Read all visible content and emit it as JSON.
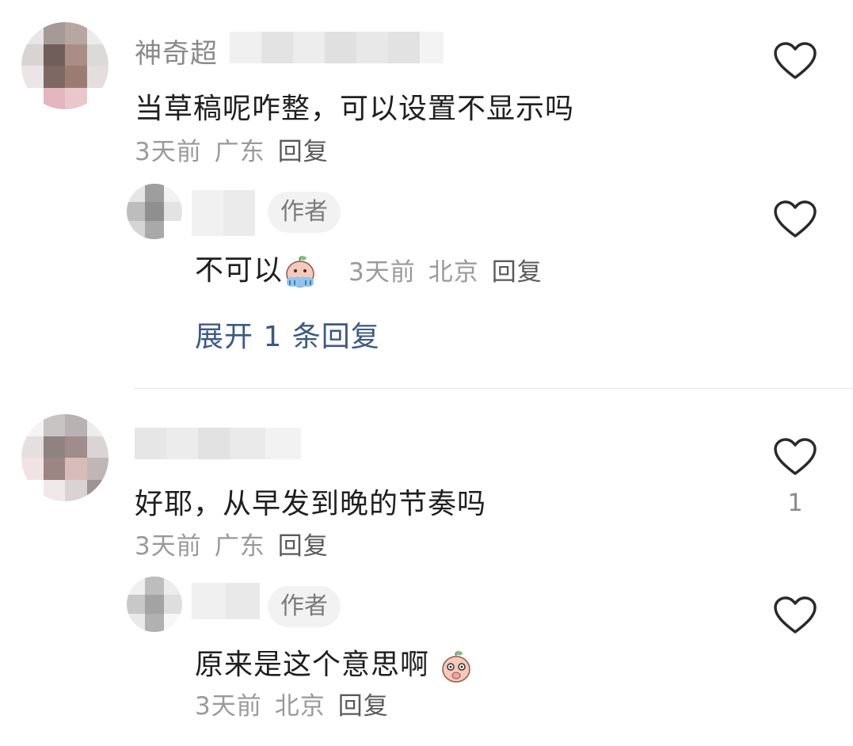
{
  "comments": [
    {
      "username_visible": "神奇超",
      "text": "当草稿呢咋整，可以设置不显示吗",
      "time": "3天前",
      "location": "广东",
      "reply_label": "回复",
      "likes": "",
      "replies": [
        {
          "author_tag": "作者",
          "text": "不可以",
          "emoji": "crying-emoji",
          "time": "3天前",
          "location": "北京",
          "reply_label": "回复"
        }
      ],
      "expand_label": "展开 1 条回复"
    },
    {
      "username_visible": "",
      "text": "好耶，从早发到晚的节奏吗",
      "time": "3天前",
      "location": "广东",
      "reply_label": "回复",
      "likes": "1",
      "replies": [
        {
          "author_tag": "作者",
          "text": "原来是这个意思啊",
          "emoji": "surprised-emoji",
          "time": "3天前",
          "location": "北京",
          "reply_label": "回复"
        }
      ]
    }
  ],
  "icons": {
    "like": "heart-outline-icon"
  },
  "colors": {
    "link": "#3b5a86",
    "meta": "#9a9a9a",
    "text": "#1f1f1f"
  }
}
